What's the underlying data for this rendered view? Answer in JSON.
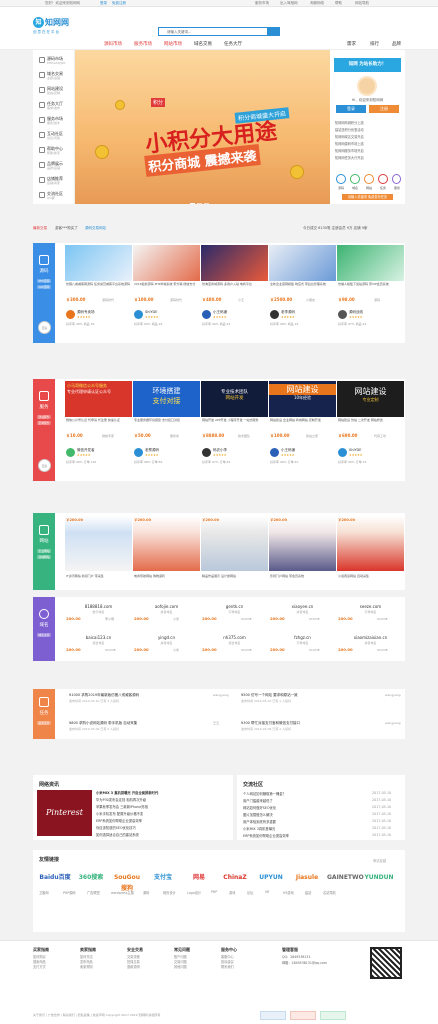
{
  "topbar": {
    "welcome": "您好！欢迎来到知网网",
    "login": "登录",
    "register": "免费注册",
    "links": [
      "服务市场",
      "出入驾相网",
      "淘服网络",
      "帮助",
      "网站导航"
    ]
  },
  "header": {
    "logo_text": "知网网",
    "logo_mark": "知",
    "slogan": "创意在在平台",
    "search_placeholder": "请输入关键词...",
    "right_links": [
      "需求",
      "排行",
      "品牌"
    ]
  },
  "nav": {
    "items": [
      "源码市场",
      "服务市场",
      "网站市场",
      "域名交易",
      "任务大厅"
    ]
  },
  "sidebar": {
    "items": [
      {
        "title": "源码市场",
        "sub": "PHP/ASP/JSP"
      },
      {
        "title": "域名交易",
        "sub": "主题/后缀"
      },
      {
        "title": "网站建设",
        "sub": "建站/定制"
      },
      {
        "title": "任务大厅",
        "sub": "需求/发布"
      },
      {
        "title": "服务市场",
        "sub": "服务/技术"
      },
      {
        "title": "互动社区",
        "sub": "论坛/问答"
      },
      {
        "title": "帮助中心",
        "sub": "帮助/新手"
      },
      {
        "title": "品牌展示",
        "sub": "品牌/店铺"
      },
      {
        "title": "店铺推荐",
        "sub": "店铺/商家"
      },
      {
        "title": "交流社区",
        "sub": "QQ群"
      }
    ]
  },
  "banner": {
    "headline": "小积分大用途",
    "subline": "积分商城 震撼来袭",
    "tag": "积分",
    "badge": "积分商城盛大开启"
  },
  "user_panel": {
    "title": "知网 为站长助力！",
    "greeting": "Hi，欢迎来到知网网",
    "login_btn": "登录",
    "register_btn": "注册",
    "lines": [
      "知网网商城积分上线",
      "建站送积分优惠活动",
      "知网网域名交易开启",
      "知网网源码市场上线",
      "知网网服务市场开启",
      "知网网任务大厅开启"
    ],
    "icons": [
      "源码",
      "域名",
      "网站",
      "任务",
      "服务"
    ],
    "join": "请输入关键词 免费发布任务"
  },
  "ticker": {
    "label": "最新交易",
    "user": "游客***购买了",
    "item": "源码交易网站",
    "stats": "今日成交 6130笔  注册会员 9万  店铺 9家"
  },
  "sections": {
    "source": {
      "title": "源码",
      "tags": [
        "PHP源码",
        "ASP源码"
      ],
      "round": "更多"
    },
    "service": {
      "title": "服务",
      "tags": [
        "建站服务",
        "定制服务"
      ],
      "round": "更多"
    },
    "site": {
      "title": "网站",
      "tags": [
        "企业网站",
        "商城网站"
      ]
    },
    "domain": {
      "title": "域名",
      "tags": [
        "域名交易"
      ]
    },
    "task": {
      "title": "任务",
      "tags": [
        "最新任务"
      ]
    }
  },
  "source_cards": [
    {
      "desc": "仿猪八戒威客网源码 任务悬赏威客平台系统源码",
      "price": "￥300.00",
      "user": "源码时代"
    },
    {
      "desc": "2018最新源码 PHP商城系统 带分销 微信支付",
      "price": "￥100.00",
      "user": "源码时代"
    },
    {
      "desc": "仿淘宝商城源码 多用户入驻 电商平台",
      "price": "￥480.00",
      "user": "小王"
    },
    {
      "desc": "全新企业官网模板 响应式 带后台管理系统",
      "price": "￥2500.00",
      "user": "小朋友"
    },
    {
      "desc": "仿懒人模板下载站源码 带VIP会员系统",
      "price": "￥98.00",
      "user": "源码"
    }
  ],
  "source_shops": [
    {
      "name": "源码专卖场",
      "meta": "好评率 98%  商品 36"
    },
    {
      "name": "ShiYDE",
      "meta": "好评率 99%  商品 28"
    },
    {
      "name": "小王码铺",
      "meta": "好评率 96%  商品 52"
    },
    {
      "name": "老李源码",
      "meta": "好评率 98%  商品 16"
    },
    {
      "name": "源码战线",
      "meta": "好评率 97%  商品 44"
    }
  ],
  "service_cards": [
    {
      "title": "小马哥微信公众号服务",
      "sub": "专业代理申请认证公众号",
      "desc": "微信公众号认证 代申请 代注册 快速认证",
      "price": "￥10.00",
      "user": "微信专家"
    },
    {
      "title": "环境搭建",
      "sub": "支付对接",
      "desc": "专业服务器环境搭建 支付接口对接",
      "price": "￥50.00",
      "user": "服务商"
    },
    {
      "title": "专业技术团队",
      "sub": "网站开发",
      "desc": "网站开发 APP开发 小程序开发 一站式服务",
      "price": "￥8888.00",
      "user": "技术团队"
    },
    {
      "title": "网站建设",
      "sub": "10年经验",
      "desc": "网站建设 企业网站 商城网站 定制开发",
      "price": "￥100.00",
      "user": "建站之家"
    },
    {
      "title": "网站建设",
      "sub": "专业定制",
      "desc": "网站建设 仿站 二次开发 网站修改",
      "price": "￥690.00",
      "user": "代码工坊"
    }
  ],
  "service_shops": [
    {
      "name": "微信开发者",
      "meta": "好评率 99%  订单 120"
    },
    {
      "name": "老蔡源码",
      "meta": "好评率 98%  订单 86"
    },
    {
      "name": "码农小李",
      "meta": "好评率 97%  订单 65"
    },
    {
      "name": "小王码铺",
      "meta": "好评率 96%  订单 40"
    },
    {
      "name": "ShiYDE",
      "meta": "好评率 99%  订单 33"
    }
  ],
  "site_cards": [
    {
      "price": "￥200.00",
      "desc": "IT资讯网站 新闻门户 带采集"
    },
    {
      "price": "￥200.00",
      "desc": "电商导航网站 购物返利"
    },
    {
      "price": "￥200.00",
      "desc": "精品作品展示 设计类网站"
    },
    {
      "price": "￥200.00",
      "desc": "影视门户网站 带会员系统"
    },
    {
      "price": "￥200.00",
      "desc": "小说阅读网站 自动采集"
    }
  ],
  "domains_row1": [
    {
      "name": "8188818.com",
      "meta": "数字域名",
      "price": "200.00",
      "user": "李小明"
    },
    {
      "name": "aofojie.com",
      "meta": "拼音域名",
      "price": "200.00",
      "user": "小米"
    },
    {
      "name": "gentk.cn",
      "meta": "字母域名",
      "price": "200.00",
      "user": "ShiYDE"
    },
    {
      "name": "xiaoyee.cn",
      "meta": "拼音域名",
      "price": "200.00",
      "user": "ShiYDE"
    },
    {
      "name": "seeze.com",
      "meta": "字母域名",
      "price": "200.00",
      "user": "ShiYDE"
    }
  ],
  "domains_row2": [
    {
      "name": "baicai123.cn",
      "meta": "组合域名",
      "price": "200.00",
      "user": "ShiYDE"
    },
    {
      "name": "yingd.cn",
      "meta": "拼音域名",
      "price": "200.00",
      "user": "小米"
    },
    {
      "name": "nh375.com",
      "meta": "组合域名",
      "price": "200.00",
      "user": "ShiYDE"
    },
    {
      "name": "fzhgz.cn",
      "meta": "字母域名",
      "price": "200.00",
      "user": "ShiYDE"
    },
    {
      "name": "xiaomizaixian.cn",
      "meta": "拼音域名",
      "price": "200.00",
      "user": "ShiYDE"
    }
  ],
  "tasks": [
    {
      "title": "¥1000 求购2019年最新版仿猪八戒威客源码",
      "sub": "发布时间 2019-05-10  已有 3 人投标",
      "user": "wangyang"
    },
    {
      "title": "¥500 仿写一个网站 要求和原站一致",
      "sub": "发布时间 2019-05-10  已有 1 人投标",
      "user": "wangyang"
    },
    {
      "title": "¥800 求购小说网站源码 带手机版 自动采集",
      "sub": "发布时间 2019-05-09  已有 5 人投标",
      "user": "王五"
    },
    {
      "title": "¥300 帮忙对接支付宝和微信支付接口",
      "sub": "发布时间 2019-05-09  已有 2 人投标",
      "user": "wangyang"
    }
  ],
  "news": {
    "title": "网络资讯",
    "image_text": "Pinterest",
    "lines": [
      "小米MIX 3 真机首曝光 开启全面屏新时代",
      "华为P30发布会定档 相机再次升级",
      "苹果秋季发布会 三款新iPhone亮相",
      "小米手机发布 配置升级价格不变",
      "ERP系统如何帮助企业提高效率",
      "你应该知道的SEO优化技巧",
      "如何选择适合自己的建站系统"
    ]
  },
  "exchange": {
    "title": "交流社区",
    "lines": [
      "个人网站如何赚取第一桶金？",
      "用户门槛越来越低了",
      "网站如何做好SEO优化",
      "图片加载慢怎么解决",
      "用户体验到底有多重要",
      "小米MIX 3真机首曝光",
      "ERP系统如何帮助企业提高效率"
    ],
    "date": "2017-05-10"
  },
  "links": {
    "title": "友情链接",
    "more": "申请友链",
    "logos": [
      "Baidu百度",
      "360搜索",
      "SouGou搜狗",
      "支付宝",
      "网易",
      "ChinaZ",
      "UPYUN",
      "Jiasule",
      "GAINETWO",
      "YUNDUN"
    ],
    "texts": [
      "卫客网",
      "PHP源码",
      "广告联盟",
      "wordpress主题",
      "源码",
      "网页设计",
      "Logo设计",
      "PHP",
      "游戏",
      "论坛",
      "VR",
      "H5游戏",
      "建站",
      "名站导航"
    ]
  },
  "footer": {
    "cols": [
      {
        "h": "买家指南",
        "i": [
          "如何购买",
          "搜索商品",
          "支付方式"
        ]
      },
      {
        "h": "卖家指南",
        "i": [
          "如何开店",
          "发布商品",
          "卖家规则"
        ]
      },
      {
        "h": "安全交易",
        "i": [
          "交易流程",
          "担保交易",
          "退款说明"
        ]
      },
      {
        "h": "常见问题",
        "i": [
          "账户问题",
          "交易问题",
          "其他问题"
        ]
      },
      {
        "h": "服务中心",
        "i": [
          "客服中心",
          "投诉建议",
          "联系我们"
        ]
      }
    ],
    "manager": "管理客服",
    "qq1": "QQ：2849538131",
    "qq2": "邮箱：2849538131@qq.com",
    "copyright": "关于我们 | 广告合作 | 联系我们 | 隐私政策 | 免责声明    Copyright 2017-2019 知网网 版权所有"
  },
  "colors": {
    "blue": "#2a8fd4",
    "red": "#e13a3a",
    "orange": "#e8741b"
  }
}
